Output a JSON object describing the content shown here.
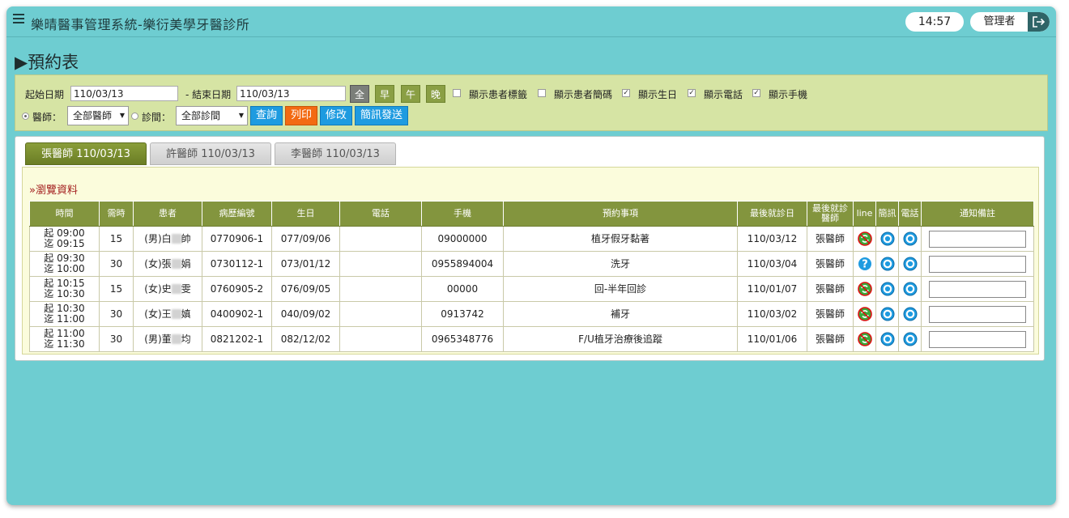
{
  "header": {
    "title": "樂晴醫事管理系統-樂衍美學牙醫診所",
    "time": "14:57",
    "user": "管理者"
  },
  "page": {
    "title": "▶預約表"
  },
  "filters": {
    "start_label": "起始日期",
    "start_value": "110/03/13",
    "end_label": "- 結束日期",
    "end_value": "110/03/13",
    "shifts": [
      {
        "label": "全",
        "active": true
      },
      {
        "label": "早",
        "active": false
      },
      {
        "label": "午",
        "active": false
      },
      {
        "label": "晚",
        "active": false
      }
    ],
    "options": [
      {
        "label": "顯示患者標籤",
        "checked": false
      },
      {
        "label": "顯示患者簡碼",
        "checked": false
      },
      {
        "label": "顯示生日",
        "checked": true
      },
      {
        "label": "顯示電話",
        "checked": true
      },
      {
        "label": "顯示手機",
        "checked": true
      }
    ],
    "doctor_label": "醫師：",
    "doctor_value": "全部醫師",
    "clinic_label": "診間：",
    "clinic_value": "全部診間",
    "buttons": {
      "query": "查詢",
      "print": "列印",
      "modify": "修改",
      "sms": "簡訊發送"
    }
  },
  "tabs": [
    {
      "label": "張醫師 110/03/13",
      "active": true
    },
    {
      "label": "許醫師 110/03/13",
      "active": false
    },
    {
      "label": "李醫師 110/03/13",
      "active": false
    }
  ],
  "section_title": "»瀏覽資料",
  "table": {
    "headers": [
      "時間",
      "需時",
      "患者",
      "病歷編號",
      "生日",
      "電話",
      "手機",
      "預約事項",
      "最後就診日",
      "最後就診醫師",
      "line",
      "簡訊",
      "電話",
      "通知備註"
    ],
    "rows": [
      {
        "time_start": "起 09:00",
        "time_end": "迄 09:15",
        "duration": "15",
        "patient_prefix": "(男)白",
        "patient_suffix": "帥",
        "record_no": "0770906-1",
        "birthday": "077/09/06",
        "phone": "",
        "mobile": "09000000",
        "item": "植牙假牙黏著",
        "last_visit": "110/03/12",
        "last_doctor": "張醫師",
        "line_status": "linked"
      },
      {
        "time_start": "起 09:30",
        "time_end": "迄 10:00",
        "duration": "30",
        "patient_prefix": "(女)張",
        "patient_suffix": "娟",
        "record_no": "0730112-1",
        "birthday": "073/01/12",
        "phone": "",
        "mobile": "0955894004",
        "item": "洗牙",
        "last_visit": "110/03/04",
        "last_doctor": "張醫師",
        "line_status": "unknown"
      },
      {
        "time_start": "起 10:15",
        "time_end": "迄 10:30",
        "duration": "15",
        "patient_prefix": "(女)史",
        "patient_suffix": "雯",
        "record_no": "0760905-2",
        "birthday": "076/09/05",
        "phone": "",
        "mobile": "00000",
        "item": "回-半年回診",
        "last_visit": "110/01/07",
        "last_doctor": "張醫師",
        "line_status": "linked"
      },
      {
        "time_start": "起 10:30",
        "time_end": "迄 11:00",
        "duration": "30",
        "patient_prefix": "(女)王",
        "patient_suffix": "嫃",
        "record_no": "0400902-1",
        "birthday": "040/09/02",
        "phone": "",
        "mobile": "0913742",
        "item": "補牙",
        "last_visit": "110/03/02",
        "last_doctor": "張醫師",
        "line_status": "linked"
      },
      {
        "time_start": "起 11:00",
        "time_end": "迄 11:30",
        "duration": "30",
        "patient_prefix": "(男)董",
        "patient_suffix": "均",
        "record_no": "0821202-1",
        "birthday": "082/12/02",
        "phone": "",
        "mobile": "0965348776",
        "item": "F/U植牙治療後追蹤",
        "last_visit": "110/01/06",
        "last_doctor": "張醫師",
        "line_status": "linked"
      }
    ]
  },
  "colors": {
    "background": "#6ecdd1",
    "accent_green": "#83953e",
    "button_blue": "#1e9be0",
    "button_orange": "#f36a12",
    "alert_red": "#a31e1e"
  },
  "icons": {
    "menu": "hamburger-icon",
    "logout": "logout-icon",
    "line_linked": "line-sync-icon",
    "line_unknown": "question-icon",
    "sms": "target-circle-icon",
    "phone": "target-circle-icon"
  }
}
